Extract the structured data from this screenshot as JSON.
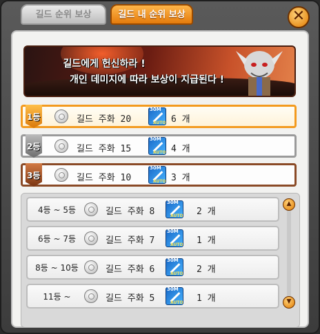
{
  "tabs": [
    {
      "label": "길드 순위 보상"
    },
    {
      "label": "길드 내 순위 보상"
    }
  ],
  "close_label": "✕",
  "banner": {
    "line1": "길드에게 헌신하라 !",
    "line2": "개인 데미지에 따라 보상이 지급된다 !"
  },
  "ticket": {
    "top_text": "30M",
    "bottom_text": "AUTO"
  },
  "top_ranks": [
    {
      "rank": "1등",
      "item": "길드 주화 20",
      "count": "6 개"
    },
    {
      "rank": "2등",
      "item": "길드 주화 15",
      "count": "4 개"
    },
    {
      "rank": "3등",
      "item": "길드 주화 10",
      "count": "3 개"
    }
  ],
  "list_ranks": [
    {
      "rank": "4등 ~ 5등",
      "item": "길드 주화 8",
      "count": "2 개"
    },
    {
      "rank": "6등 ~ 7등",
      "item": "길드 주화 7",
      "count": "1 개"
    },
    {
      "rank": "8등 ~ 10등",
      "item": "길드 주화 6",
      "count": "2 개"
    },
    {
      "rank": "11등 ~",
      "item": "길드 주화 5",
      "count": "1 개"
    }
  ],
  "icons": {
    "coin": "guild-coin-icon",
    "ticket": "auto-ticket-icon",
    "scroll_up": "scroll-up-icon",
    "scroll_down": "scroll-down-icon"
  }
}
